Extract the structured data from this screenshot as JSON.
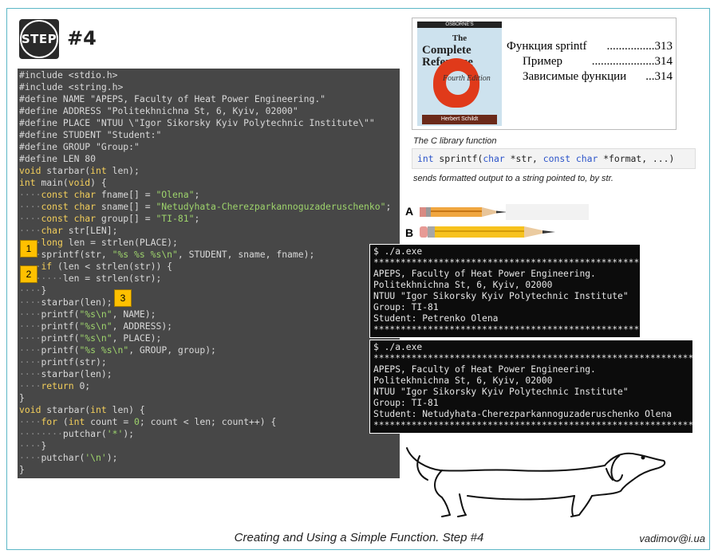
{
  "header": {
    "logo_text": "STEP",
    "step_label": "#4"
  },
  "code_lines": [
    [
      [
        "#include <stdio.h>",
        ""
      ]
    ],
    [
      [
        "#include <string.h>",
        ""
      ]
    ],
    [
      [
        "#define NAME \"APEPS, Faculty of Heat Power Engineering.\"",
        ""
      ]
    ],
    [
      [
        "#define ADDRESS \"Politekhnichna St, 6, Kyiv, 02000\"",
        ""
      ]
    ],
    [
      [
        "#define PLACE \"NTUU \\\"Igor Sikorsky Kyiv Polytechnic Institute\\\"\"",
        ""
      ]
    ],
    [
      [
        "#define STUDENT \"Student:\"",
        ""
      ]
    ],
    [
      [
        "#define GROUP \"Group:\"",
        ""
      ]
    ],
    [
      [
        "#define LEN 80",
        ""
      ]
    ],
    [
      [
        "void",
        "kw"
      ],
      [
        " starbar(",
        ""
      ],
      [
        "int",
        "kw"
      ],
      [
        " len);",
        ""
      ]
    ],
    [
      [
        "int",
        "kw"
      ],
      [
        " main(",
        ""
      ],
      [
        "void",
        "kw"
      ],
      [
        ") {",
        ""
      ]
    ],
    [
      [
        "····",
        "ws"
      ],
      [
        "const char",
        "kw"
      ],
      [
        " fname[] = ",
        ""
      ],
      [
        "\"Olena\"",
        "str"
      ],
      [
        ";",
        ""
      ]
    ],
    [
      [
        "····",
        "ws"
      ],
      [
        "const char",
        "kw"
      ],
      [
        " sname[] = ",
        ""
      ],
      [
        "\"Netudyhata-Cherezparkannoguzaderuschenko\"",
        "str"
      ],
      [
        ";",
        ""
      ]
    ],
    [
      [
        "····",
        "ws"
      ],
      [
        "const char",
        "kw"
      ],
      [
        " group[] = ",
        ""
      ],
      [
        "\"TI-81\"",
        "str"
      ],
      [
        ";",
        ""
      ]
    ],
    [
      [
        "····",
        "ws"
      ],
      [
        "char",
        "kw"
      ],
      [
        " str[LEN];",
        ""
      ]
    ],
    [
      [
        "····",
        "ws"
      ],
      [
        "long",
        "kw"
      ],
      [
        " len = strlen(PLACE);",
        ""
      ]
    ],
    [
      [
        "····",
        "ws"
      ],
      [
        "sprintf(str, ",
        ""
      ],
      [
        "\"%s %s %s\\n\"",
        "str"
      ],
      [
        ", STUDENT, sname, fname);",
        ""
      ]
    ],
    [
      [
        "····",
        "ws"
      ],
      [
        "if",
        "kw"
      ],
      [
        " (len < strlen(str)) {",
        ""
      ]
    ],
    [
      [
        "········",
        "ws"
      ],
      [
        "len = strlen(str);",
        ""
      ]
    ],
    [
      [
        "····",
        "ws"
      ],
      [
        "}",
        ""
      ]
    ],
    [
      [
        "····",
        "ws"
      ],
      [
        "starbar(len);",
        ""
      ]
    ],
    [
      [
        "····",
        "ws"
      ],
      [
        "printf(",
        ""
      ],
      [
        "\"%s\\n\"",
        "str"
      ],
      [
        ", NAME);",
        ""
      ]
    ],
    [
      [
        "····",
        "ws"
      ],
      [
        "printf(",
        ""
      ],
      [
        "\"%s\\n\"",
        "str"
      ],
      [
        ", ADDRESS);",
        ""
      ]
    ],
    [
      [
        "····",
        "ws"
      ],
      [
        "printf(",
        ""
      ],
      [
        "\"%s\\n\"",
        "str"
      ],
      [
        ", PLACE);",
        ""
      ]
    ],
    [
      [
        "····",
        "ws"
      ],
      [
        "printf(",
        ""
      ],
      [
        "\"%s %s\\n\"",
        "str"
      ],
      [
        ", GROUP, group);",
        ""
      ]
    ],
    [
      [
        "····",
        "ws"
      ],
      [
        "printf(str);",
        ""
      ]
    ],
    [
      [
        "····",
        "ws"
      ],
      [
        "starbar(len);",
        ""
      ]
    ],
    [
      [
        "····",
        "ws"
      ],
      [
        "return",
        "kw"
      ],
      [
        " 0;",
        ""
      ]
    ],
    [
      [
        "}",
        ""
      ]
    ],
    [
      [
        "void",
        "kw"
      ],
      [
        " starbar(",
        ""
      ],
      [
        "int",
        "kw"
      ],
      [
        " len) {",
        ""
      ]
    ],
    [
      [
        "····",
        "ws"
      ],
      [
        "for",
        "kw"
      ],
      [
        " (",
        ""
      ],
      [
        "int",
        "kw"
      ],
      [
        " count = ",
        ""
      ],
      [
        "0",
        "str"
      ],
      [
        "; count < len; count++) {",
        ""
      ]
    ],
    [
      [
        "········",
        "ws"
      ],
      [
        "putchar(",
        ""
      ],
      [
        "'*'",
        "str"
      ],
      [
        ");",
        ""
      ]
    ],
    [
      [
        "····",
        "ws"
      ],
      [
        "}",
        ""
      ]
    ],
    [
      [
        "····",
        "ws"
      ],
      [
        "putchar(",
        ""
      ],
      [
        "'\\n'",
        "str"
      ],
      [
        ");",
        ""
      ]
    ],
    [
      [
        "}",
        ""
      ]
    ]
  ],
  "markers": [
    "1",
    "2",
    "3"
  ],
  "book": {
    "cover_top": "OSBORNE'S",
    "cover_title_1": "The",
    "cover_title_2": "Complete",
    "cover_title_3": "Reference",
    "cover_edition": "Fourth Edition",
    "cover_author": "Herbert Schildt",
    "toc": [
      {
        "label": "Функция sprintf",
        "page": "313"
      },
      {
        "label": "Пример",
        "page": "314"
      },
      {
        "label": "Зависимые функции",
        "page": "314"
      }
    ]
  },
  "reference": {
    "caption": "The C library function",
    "prototype_kw1": "int",
    "prototype_mid1": " sprintf(",
    "prototype_kw2": "char",
    "prototype_mid2": " *str, ",
    "prototype_kw3": "const char",
    "prototype_end": " *format, ...)",
    "description": "sends formatted output to a string pointed to, by str."
  },
  "pencils": {
    "a_label": "A",
    "b_label": "B"
  },
  "terminal1": [
    "$ ./a.exe",
    "************************************************************",
    "APEPS, Faculty of Heat Power Engineering.",
    "Politekhnichna St, 6, Kyiv, 02000",
    "NTUU \"Igor Sikorsky Kyiv Polytechnic Institute\"",
    "Group: TI-81",
    "Student: Petrenko Olena",
    "************************************************************"
  ],
  "terminal2": [
    "$ ./a.exe",
    "**********************************************************************",
    "APEPS, Faculty of Heat Power Engineering.",
    "Politekhnichna St, 6, Kyiv, 02000",
    "NTUU \"Igor Sikorsky Kyiv Polytechnic Institute\"",
    "Group: TI-81",
    "Student: Netudyhata-Cherezparkannoguzaderuschenko Olena",
    "**********************************************************************"
  ],
  "footer": {
    "title": "Creating and Using a Simple Function. Step #4",
    "email": "vadimov@i.ua"
  }
}
